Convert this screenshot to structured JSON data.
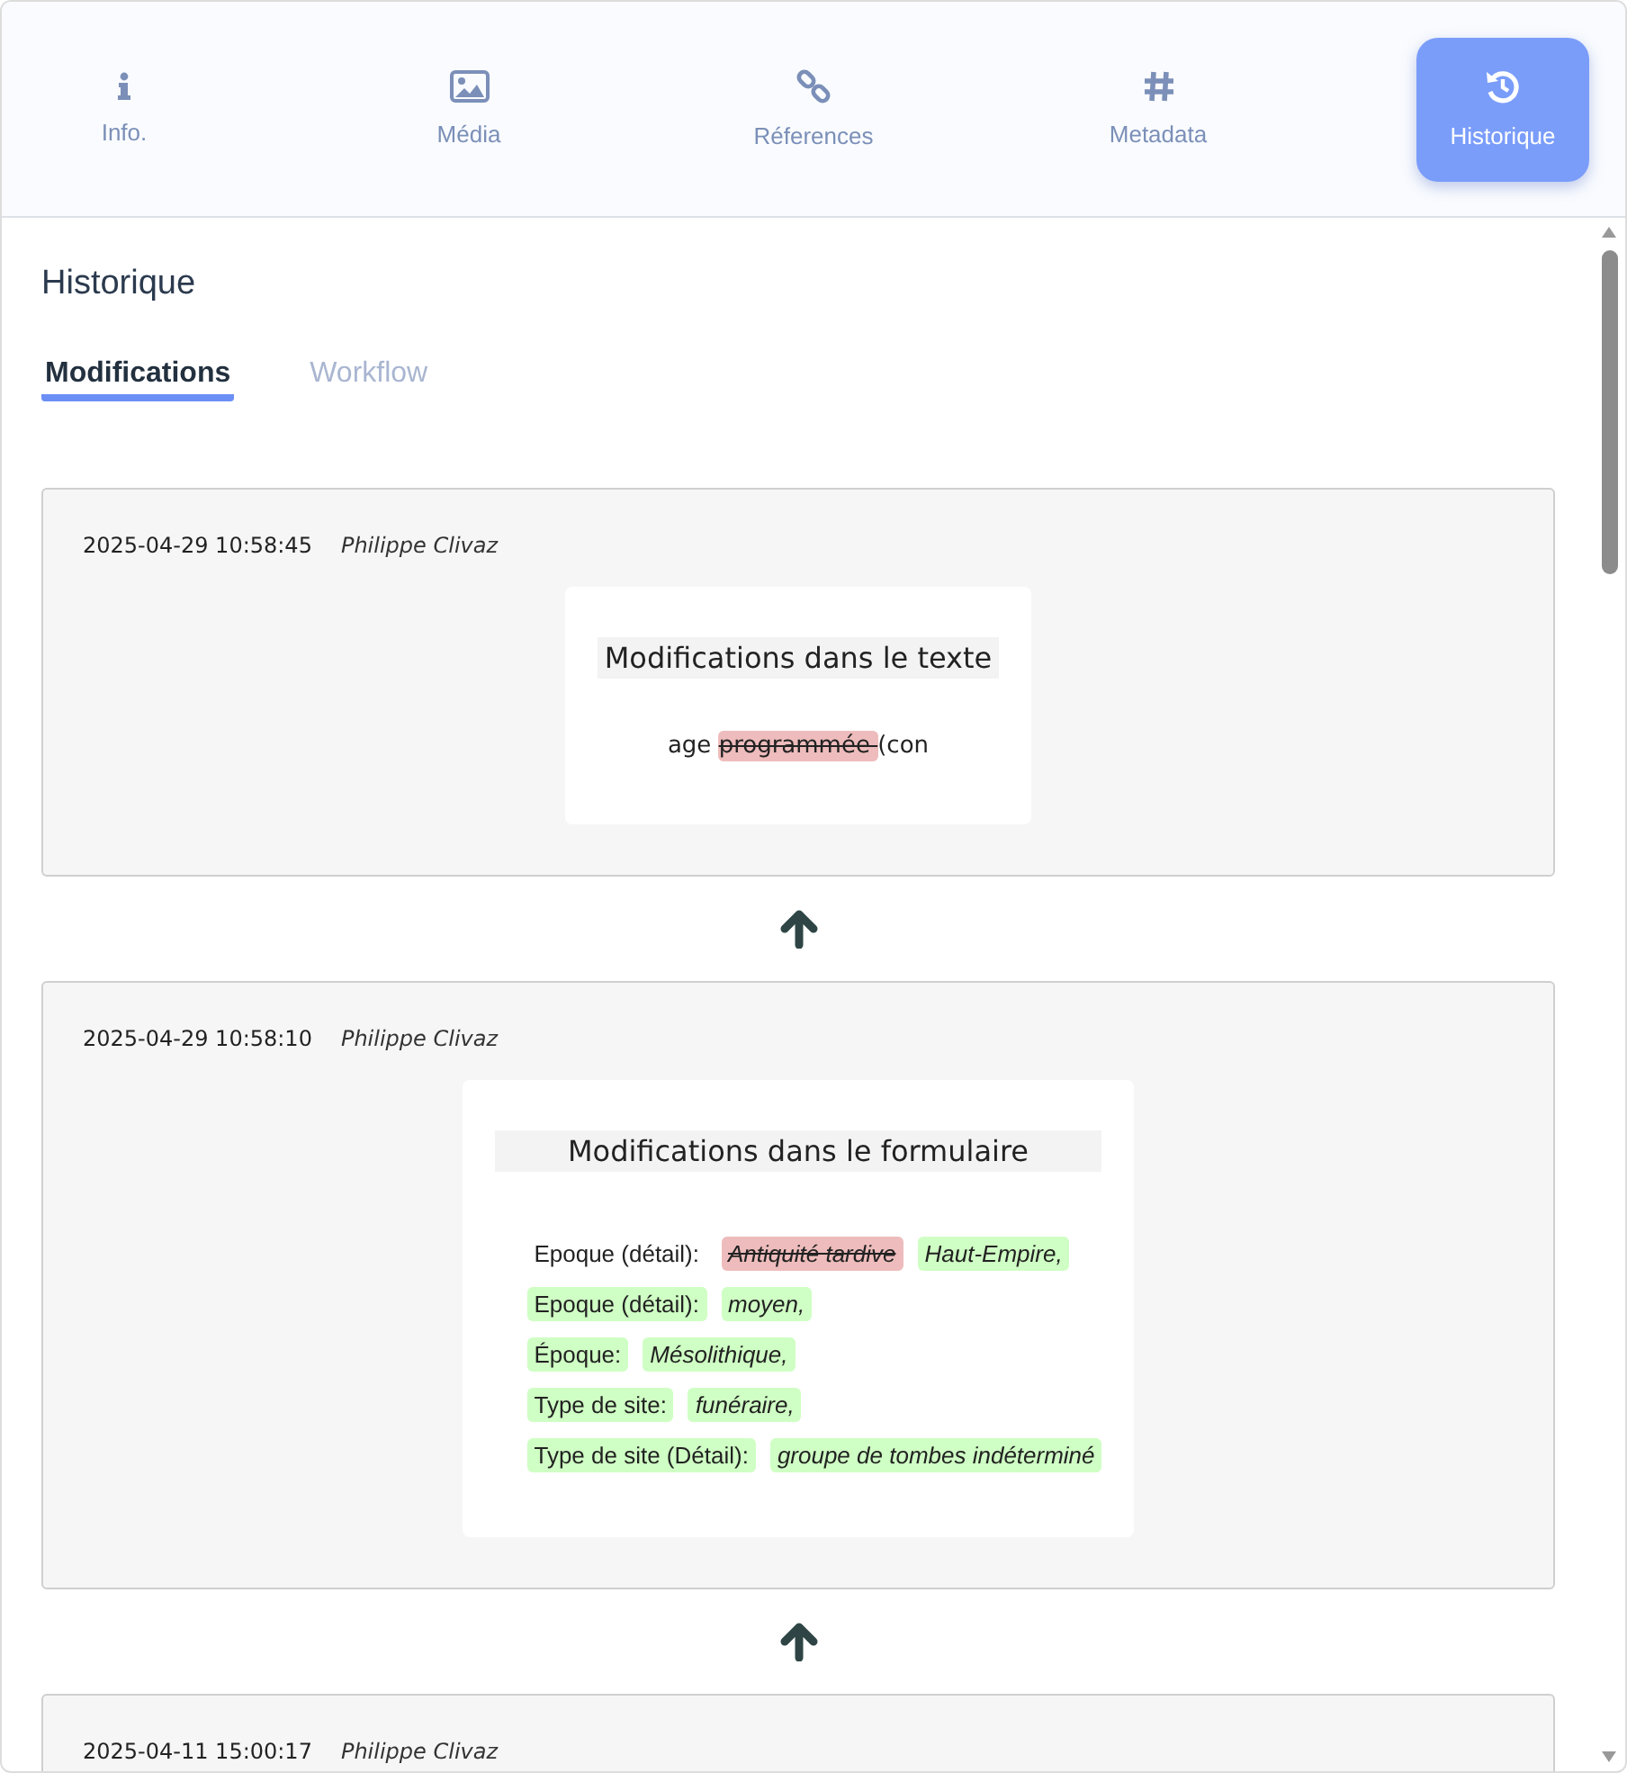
{
  "nav_tabs": [
    {
      "label": "Info.",
      "kind": "info",
      "selected": false
    },
    {
      "label": "Média",
      "kind": "media",
      "selected": false
    },
    {
      "label": "Réferences",
      "kind": "references",
      "selected": false
    },
    {
      "label": "Metadata",
      "kind": "metadata",
      "selected": false
    },
    {
      "label": "Historique",
      "kind": "history",
      "selected": true
    }
  ],
  "heading": "Historique",
  "sub_tabs": [
    {
      "label": "Modifications",
      "selected": true
    },
    {
      "label": "Workflow",
      "selected": false
    }
  ],
  "entries": [
    {
      "timestamp": "2025-04-29 10:58:45",
      "author": "Philippe Clivaz",
      "kind": "text",
      "title": "Modifications dans le texte",
      "segments": [
        {
          "text": "age ",
          "kind": "same"
        },
        {
          "text": "programmée ",
          "kind": "removed"
        },
        {
          "text": "(con",
          "kind": "same"
        }
      ]
    },
    {
      "timestamp": "2025-04-29 10:58:10",
      "author": "Philippe Clivaz",
      "kind": "form",
      "title": "Modifications dans le formulaire",
      "rows": [
        {
          "field": {
            "text": "Epoque (détail):",
            "kind": "same"
          },
          "values": [
            {
              "text": "Antiquité tardive",
              "kind": "removed"
            },
            {
              "text": "Haut-Empire,",
              "kind": "added"
            }
          ]
        },
        {
          "field": {
            "text": "Epoque (détail):",
            "kind": "added"
          },
          "values": [
            {
              "text": "moyen,",
              "kind": "added"
            }
          ]
        },
        {
          "field": {
            "text": "Époque:",
            "kind": "added"
          },
          "values": [
            {
              "text": "Mésolithique,",
              "kind": "added"
            }
          ]
        },
        {
          "field": {
            "text": "Type de site:",
            "kind": "added"
          },
          "values": [
            {
              "text": "funéraire,",
              "kind": "added"
            }
          ]
        },
        {
          "field": {
            "text": "Type de site (Détail):",
            "kind": "added"
          },
          "values": [
            {
              "text": "groupe de tombes indéterminé",
              "kind": "added"
            }
          ]
        }
      ]
    },
    {
      "timestamp": "2025-04-11 15:00:17",
      "author": "Philippe Clivaz",
      "kind": "header-only"
    }
  ]
}
